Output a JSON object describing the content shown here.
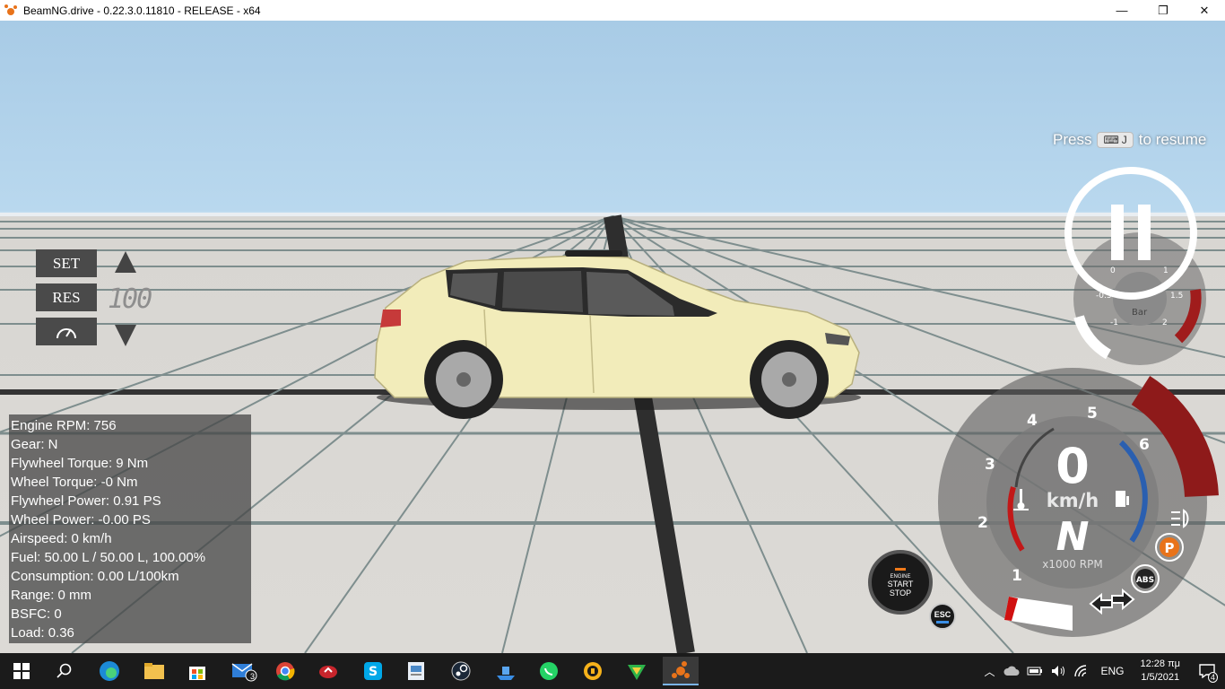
{
  "window": {
    "title": "BeamNG.drive - 0.22.3.0.11810 - RELEASE - x64",
    "minimize": "—",
    "maximize": "❐",
    "close": "✕"
  },
  "resume_hint": {
    "press": "Press",
    "key": "J",
    "suffix": "to resume"
  },
  "cruise": {
    "set": "SET",
    "res": "RES",
    "speed": "100"
  },
  "stats": [
    "Engine RPM: 756",
    "Gear: N",
    "Flywheel Torque: 9 Nm",
    "Wheel Torque: -0 Nm",
    "Flywheel Power: 0.91 PS",
    "Wheel Power: -0.00 PS",
    "Airspeed: 0 km/h",
    "Fuel: 50.00 L / 50.00 L, 100.00%",
    "Consumption: 0.00 L/100km",
    "Range: 0 mm",
    "BSFC: 0",
    "Load: 0.36"
  ],
  "boost_gauge": {
    "unit": "Bar",
    "ticks": [
      "0",
      "1",
      "1.5",
      "2",
      "-1",
      "-0.5"
    ]
  },
  "tachometer": {
    "speed": "0",
    "speed_unit": "km/h",
    "gear": "N",
    "rpm_unit": "x1000 RPM",
    "ticks": [
      "1",
      "2",
      "3",
      "4",
      "5",
      "6"
    ],
    "abs": "ABS",
    "parking": "P"
  },
  "startstop": {
    "line1": "ENGINE",
    "line2": "START",
    "line3": "STOP"
  },
  "esc": {
    "label": "ESC"
  },
  "taskbar": {
    "mail_badge": "3",
    "lang": "ENG",
    "time": "12:28 πμ",
    "date": "1/5/2021",
    "notif_count": "4"
  },
  "colors": {
    "accent": "#e8731a",
    "redline": "#a01c1c",
    "blue": "#2a5fb0",
    "taskbar": "#1b1b1b"
  }
}
